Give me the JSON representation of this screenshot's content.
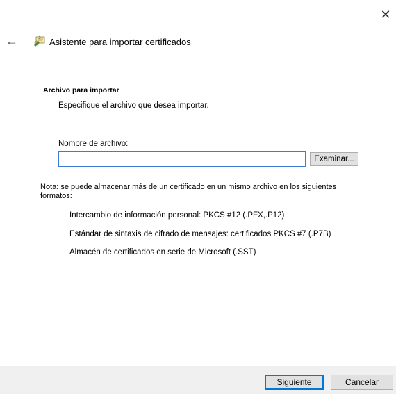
{
  "window": {
    "title": "Asistente para importar certificados",
    "close_label": "✕",
    "back_label": "←"
  },
  "section": {
    "title": "Archivo para importar",
    "description": "Especifique el archivo que desea importar."
  },
  "file": {
    "label": "Nombre de archivo:",
    "value": "",
    "browse_label": "Examinar..."
  },
  "note": {
    "text": "Nota: se puede almacenar más de un certificado en un mismo archivo en los siguientes formatos:",
    "formats": [
      "Intercambio de información personal: PKCS #12 (.PFX,.P12)",
      "Estándar de sintaxis de cifrado de mensajes: certificados PKCS #7 (.P7B)",
      "Almacén de certificados en serie de Microsoft (.SST)"
    ]
  },
  "buttons": {
    "next": "Siguiente",
    "cancel": "Cancelar"
  },
  "colors": {
    "accent": "#0078d7",
    "footer_bg": "#f0f0f0"
  },
  "icons": {
    "back": "arrow-left-icon",
    "wizard": "certificate-wizard-icon",
    "close": "close-icon"
  }
}
